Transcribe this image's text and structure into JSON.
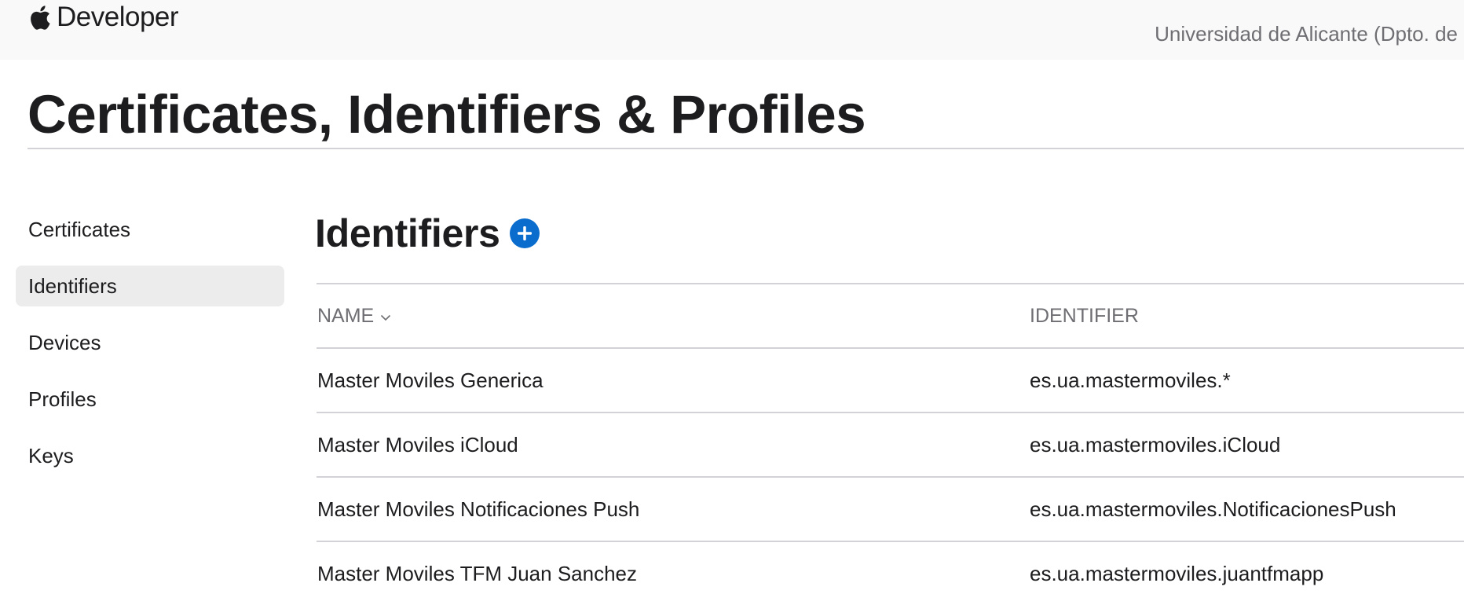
{
  "header": {
    "brand_text": "Developer",
    "team_name": "Universidad de Alicante (Dpto. de"
  },
  "page_title": "Certificates, Identifiers & Profiles",
  "sidebar": {
    "items": [
      {
        "label": "Certificates",
        "active": false
      },
      {
        "label": "Identifiers",
        "active": true
      },
      {
        "label": "Devices",
        "active": false
      },
      {
        "label": "Profiles",
        "active": false
      },
      {
        "label": "Keys",
        "active": false
      }
    ]
  },
  "section": {
    "title": "Identifiers",
    "add_icon": "plus-circle-icon"
  },
  "table": {
    "columns": [
      "NAME",
      "IDENTIFIER"
    ],
    "sort_icon": "chevron-down-icon",
    "rows": [
      {
        "name": "Master Moviles Generica",
        "identifier": "es.ua.mastermoviles.*"
      },
      {
        "name": "Master Moviles iCloud",
        "identifier": "es.ua.mastermoviles.iCloud"
      },
      {
        "name": "Master Moviles Notificaciones Push",
        "identifier": "es.ua.mastermoviles.NotificacionesPush"
      },
      {
        "name": "Master Moviles TFM Juan Sanchez",
        "identifier": "es.ua.mastermoviles.juantfmapp"
      }
    ]
  },
  "colors": {
    "accent": "#0a6ccc",
    "text": "#1d1d1f",
    "muted": "#6e6e73",
    "topbar_bg": "#f9f9f9",
    "active_nav_bg": "#ececec"
  }
}
